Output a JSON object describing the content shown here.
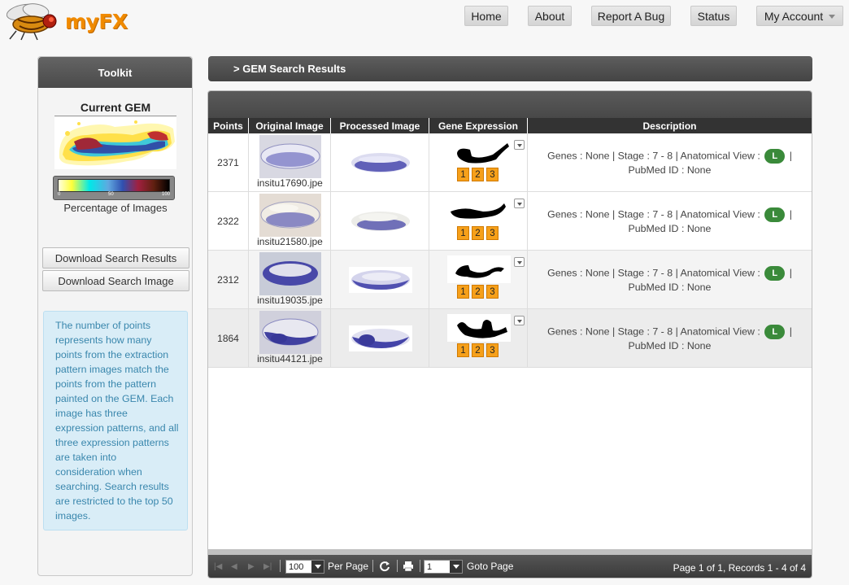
{
  "app": {
    "title": "myFX"
  },
  "nav": {
    "home": "Home",
    "about": "About",
    "report_bug": "Report A Bug",
    "status": "Status",
    "my_account": "My Account"
  },
  "sidebar": {
    "title": "Toolkit",
    "current_gem": "Current GEM",
    "scale_min": "0",
    "scale_mid": "50",
    "scale_max": "100",
    "scale_caption": "Percentage of Images",
    "download_results": "Download Search Results",
    "download_image": "Download Search Image",
    "info": "The number of points represents how many points from the extraction pattern images match the points from the pattern painted on the GEM. Each image has three expression patterns, and all three expression patterns are taken into consideration when searching. Search results are restricted to the top 50 images."
  },
  "results": {
    "title": "> GEM Search Results",
    "columns": {
      "points": "Points",
      "original": "Original Image",
      "processed": "Processed Image",
      "gene": "Gene Expression",
      "description": "Description"
    },
    "rows": [
      {
        "points": "2371",
        "filename": "insitu17690.jpe",
        "desc_a": "Genes : None | Stage : 7 - 8 | Anatomical View :",
        "view": "L",
        "desc_b": "|",
        "desc_c": "PubMed ID : None",
        "p1": "1",
        "p2": "2",
        "p3": "3"
      },
      {
        "points": "2322",
        "filename": "insitu21580.jpe",
        "desc_a": "Genes : None | Stage : 7 - 8 | Anatomical View :",
        "view": "L",
        "desc_b": "|",
        "desc_c": "PubMed ID : None",
        "p1": "1",
        "p2": "2",
        "p3": "3"
      },
      {
        "points": "2312",
        "filename": "insitu19035.jpe",
        "desc_a": "Genes : None | Stage : 7 - 8 | Anatomical View :",
        "view": "L",
        "desc_b": "|",
        "desc_c": "PubMed ID : None",
        "p1": "1",
        "p2": "2",
        "p3": "3"
      },
      {
        "points": "1864",
        "filename": "insitu44121.jpe",
        "desc_a": "Genes : None | Stage : 7 - 8 | Anatomical View :",
        "view": "L",
        "desc_b": "|",
        "desc_c": "PubMed ID : None",
        "p1": "1",
        "p2": "2",
        "p3": "3"
      }
    ]
  },
  "pager": {
    "per_page_value": "100",
    "per_page_label": "Per Page",
    "goto_value": "1",
    "goto_label": "Goto Page",
    "summary": "Page 1 of 1, Records 1 - 4 of 4"
  },
  "colors": {
    "accent": "#f08a00",
    "badge": "#3a8a3a",
    "pattern_button": "#f6a01a",
    "info_bg": "#d9edf7",
    "info_text": "#3a87ad"
  },
  "icons": [
    "fly-logo-icon",
    "chevron-down-icon",
    "first-page-icon",
    "prev-page-icon",
    "next-page-icon",
    "last-page-icon",
    "refresh-icon",
    "print-icon"
  ]
}
